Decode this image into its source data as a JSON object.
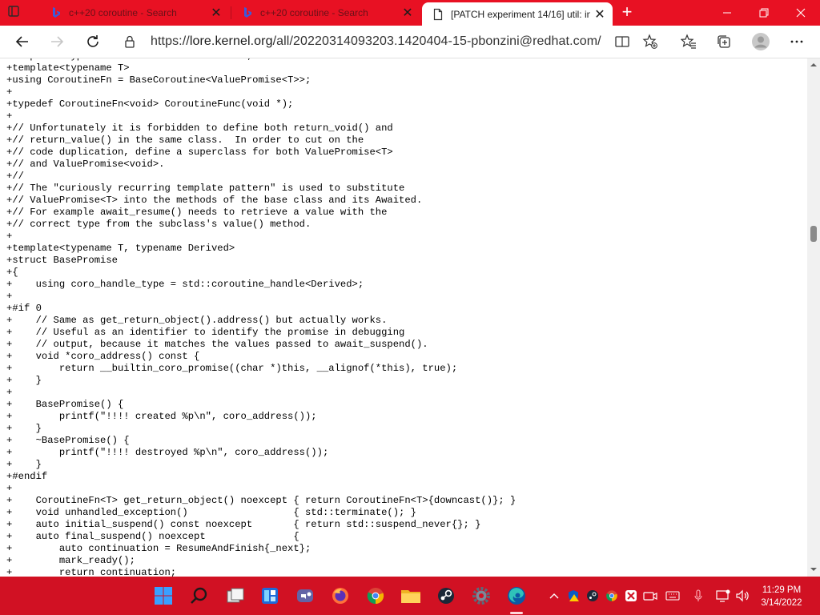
{
  "browser": {
    "tabs": [
      {
        "title": "c++20 coroutine - Search",
        "active": false,
        "icon": "bing-icon"
      },
      {
        "title": "c++20 coroutine - Search",
        "active": false,
        "icon": "bing-icon"
      },
      {
        "title": "[PATCH experiment 14/16] util: in",
        "active": true,
        "icon": "page-icon"
      }
    ],
    "address": {
      "scheme": "https://",
      "host": "lore.kernel.org",
      "path": "/all/20220314093203.1420404-15-pbonzini@redhat.com/"
    },
    "colors": {
      "tabstrip": "#e81123",
      "taskbar": "#d11123"
    }
  },
  "code_lines": [
    "+template<typename T> struct ValuePromise;",
    "+template<typename T>",
    "+using CoroutineFn = BaseCoroutine<ValuePromise<T>>;",
    "+",
    "+typedef CoroutineFn<void> CoroutineFunc(void *);",
    "+",
    "+// Unfortunately it is forbidden to define both return_void() and",
    "+// return_value() in the same class.  In order to cut on the",
    "+// code duplication, define a superclass for both ValuePromise<T>",
    "+// and ValuePromise<void>.",
    "+//",
    "+// The \"curiously recurring template pattern\" is used to substitute",
    "+// ValuePromise<T> into the methods of the base class and its Awaited.",
    "+// For example await_resume() needs to retrieve a value with the",
    "+// correct type from the subclass's value() method.",
    "+",
    "+template<typename T, typename Derived>",
    "+struct BasePromise",
    "+{",
    "+    using coro_handle_type = std::coroutine_handle<Derived>;",
    "+",
    "+#if 0",
    "+    // Same as get_return_object().address() but actually works.",
    "+    // Useful as an identifier to identify the promise in debugging",
    "+    // output, because it matches the values passed to await_suspend().",
    "+    void *coro_address() const {",
    "+        return __builtin_coro_promise((char *)this, __alignof(*this), true);",
    "+    }",
    "+",
    "+    BasePromise() {",
    "+        printf(\"!!!! created %p\\n\", coro_address());",
    "+    }",
    "+    ~BasePromise() {",
    "+        printf(\"!!!! destroyed %p\\n\", coro_address());",
    "+    }",
    "+#endif",
    "+",
    "+    CoroutineFn<T> get_return_object() noexcept { return CoroutineFn<T>{downcast()}; }",
    "+    void unhandled_exception()                  { std::terminate(); }",
    "+    auto initial_suspend() const noexcept       { return std::suspend_never{}; }",
    "+    auto final_suspend() noexcept               {",
    "+        auto continuation = ResumeAndFinish{_next};",
    "+        mark_ready();",
    "+        return continuation;"
  ],
  "taskbar": {
    "apps": [
      "start-icon",
      "search-icon",
      "task-view-icon",
      "widgets-icon",
      "teams-chat-icon",
      "firefox-icon",
      "chrome-icon",
      "file-explorer-icon",
      "steam-icon",
      "settings-icon",
      "edge-icon"
    ],
    "time": "11:29 PM",
    "date": "3/14/2022"
  }
}
